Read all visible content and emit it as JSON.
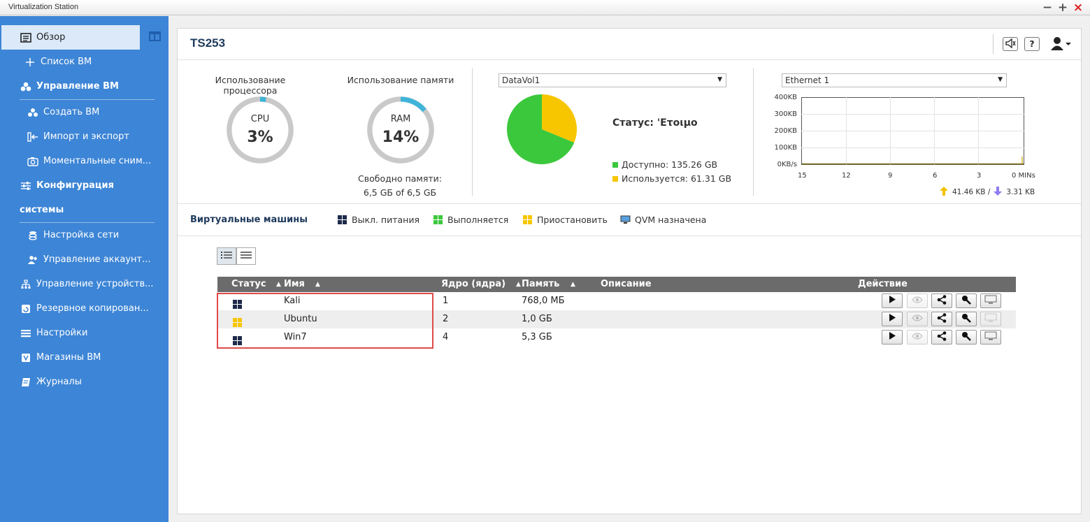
{
  "window": {
    "title": "Virtualization Station",
    "minimize": "−",
    "maximize": "+",
    "close": "×"
  },
  "sidebar": {
    "items": [
      {
        "label": "Обзор",
        "icon": "overview-icon",
        "active": true
      },
      {
        "label": "Список ВМ",
        "icon": "plus-icon"
      },
      {
        "label": "Управление ВМ",
        "icon": "vm-management-icon",
        "bold": true
      },
      {
        "label": "Создать ВМ",
        "icon": "create-vm-icon"
      },
      {
        "label": "Импорт и экспорт",
        "icon": "import-export-icon"
      },
      {
        "label": "Моментальные сним...",
        "icon": "camera-icon"
      },
      {
        "label": "Конфигурация",
        "icon": "sliders-icon",
        "bold": true
      },
      {
        "label": "системы",
        "bold": true
      },
      {
        "label": "Настройка сети",
        "icon": "network-icon"
      },
      {
        "label": "Управление аккаунт...",
        "icon": "users-icon"
      },
      {
        "label": "Управление устройств...",
        "icon": "devices-icon"
      },
      {
        "label": "Резервное копирован...",
        "icon": "backup-icon"
      },
      {
        "label": "Настройки",
        "icon": "settings-icon"
      },
      {
        "label": "Магазины ВМ",
        "icon": "store-icon"
      },
      {
        "label": "Журналы",
        "icon": "logs-icon"
      }
    ]
  },
  "header": {
    "title": "TS253",
    "help_label": "?"
  },
  "cpu": {
    "label": "Использование процессора",
    "name": "CPU",
    "value": "3%",
    "percent": 0.03
  },
  "ram": {
    "label": "Использование памяти",
    "name": "RAM",
    "value": "14%",
    "percent": 0.14,
    "free_label": "Свободно памяти:",
    "free_value": "6,5 GБ of 6,5 GБ"
  },
  "storage": {
    "volume": "DataVol1",
    "status": "Статус: 'Ετοιμο",
    "available": "Доступно: 135.26 GB",
    "used": "Используется: 61.31 GB",
    "available_gb": 135.26,
    "used_gb": 61.31,
    "available_color": "#3cc83c",
    "used_color": "#f7c600"
  },
  "network": {
    "adapter": "Ethernet 1",
    "y_ticks": [
      "400KB",
      "300KB",
      "200KB",
      "100KB",
      "0KB/s"
    ],
    "x_ticks": [
      "15",
      "12",
      "9",
      "6",
      "3",
      "0 MINs"
    ],
    "upload": "41.46 KB /",
    "download": "3.31 KB"
  },
  "vm_section": {
    "title": "Виртуальные машины",
    "legend": [
      {
        "label": "Выкл. питания",
        "color": "#1d2a4a"
      },
      {
        "label": "Выполняется",
        "color": "#3cc83c"
      },
      {
        "label": "Приостановить",
        "color": "#f7c600"
      },
      {
        "label": "QVM назначена",
        "icon": "monitor-icon"
      }
    ]
  },
  "table": {
    "columns": [
      "Статус",
      "Имя",
      "Ядро (ядра)",
      "Память",
      "Описание",
      "Действие"
    ],
    "rows": [
      {
        "status": "off",
        "name": "Kali",
        "cores": "1",
        "memory": "768,0 МБ",
        "description": ""
      },
      {
        "status": "paused",
        "name": "Ubuntu",
        "cores": "2",
        "memory": "1,0 GБ",
        "description": ""
      },
      {
        "status": "off",
        "name": "Win7",
        "cores": "4",
        "memory": "5,3 GБ",
        "description": ""
      }
    ],
    "actions": [
      "play-icon",
      "eye-icon",
      "share-icon",
      "key-icon",
      "display-icon"
    ]
  }
}
